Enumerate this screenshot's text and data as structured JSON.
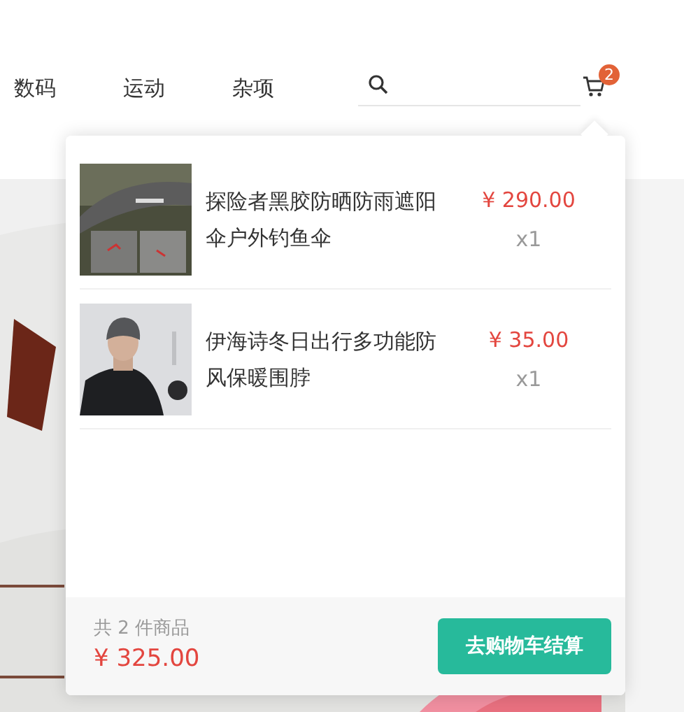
{
  "nav": [
    {
      "label": "数码"
    },
    {
      "label": "运动"
    },
    {
      "label": "杂项"
    }
  ],
  "cart": {
    "badge": "2",
    "items": [
      {
        "name": "探险者黑胶防晒防雨遮阳伞户外钓鱼伞",
        "price": "¥ 290.00",
        "quantity": "x1"
      },
      {
        "name": "伊海诗冬日出行多功能防风保暖围脖",
        "price": "¥ 35.00",
        "quantity": "x1"
      }
    ],
    "summary": "共 2 件商品",
    "total": "¥ 325.00",
    "checkout_button": "去购物车结算"
  }
}
